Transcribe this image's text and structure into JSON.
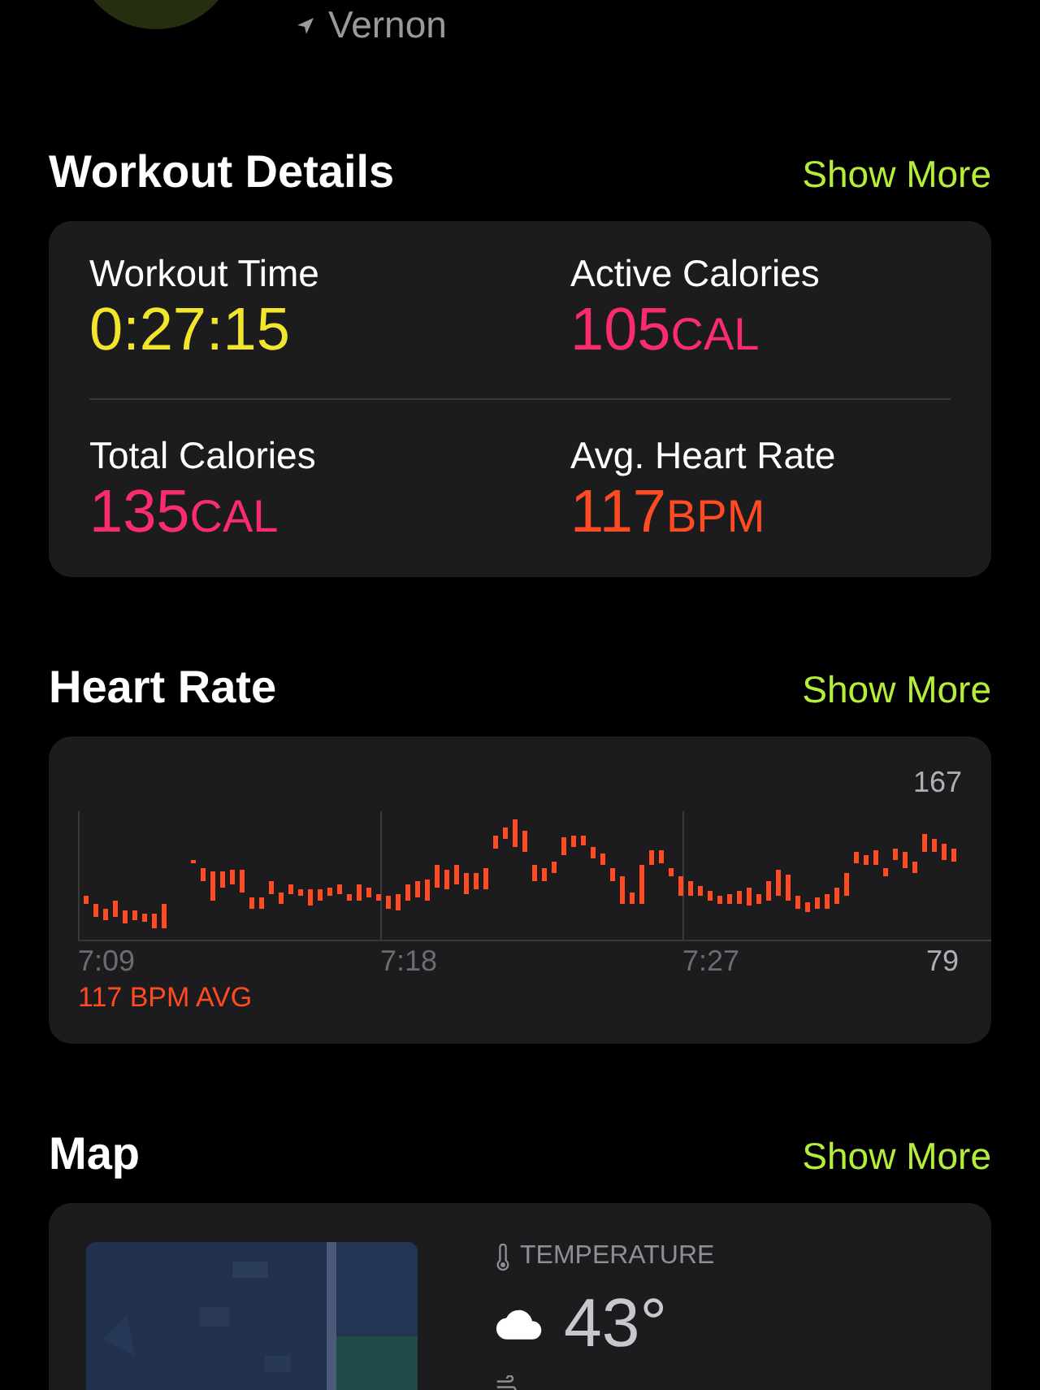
{
  "header": {
    "location": "Vernon"
  },
  "workout_details": {
    "title": "Workout Details",
    "link": "Show More",
    "metrics": [
      {
        "label": "Workout Time",
        "value": "0:27:15",
        "color": "#f2e52c"
      },
      {
        "label": "Active Calories",
        "value": "105",
        "unit": "CAL",
        "color": "#fa2c6c"
      },
      {
        "label": "Total Calories",
        "value": "135",
        "unit": "CAL",
        "color": "#fa2c6c"
      },
      {
        "label": "Avg. Heart Rate",
        "value": "117",
        "unit": "BPM",
        "color": "#ff4a22"
      }
    ]
  },
  "heart_rate": {
    "title": "Heart Rate",
    "link": "Show More",
    "max": "167",
    "min": "79",
    "times": [
      "7:09",
      "7:18",
      "7:27"
    ],
    "average": "117 BPM AVG"
  },
  "map": {
    "title": "Map",
    "link": "Show More",
    "temperature_label": "TEMPERATURE",
    "temperature": "43°"
  }
}
